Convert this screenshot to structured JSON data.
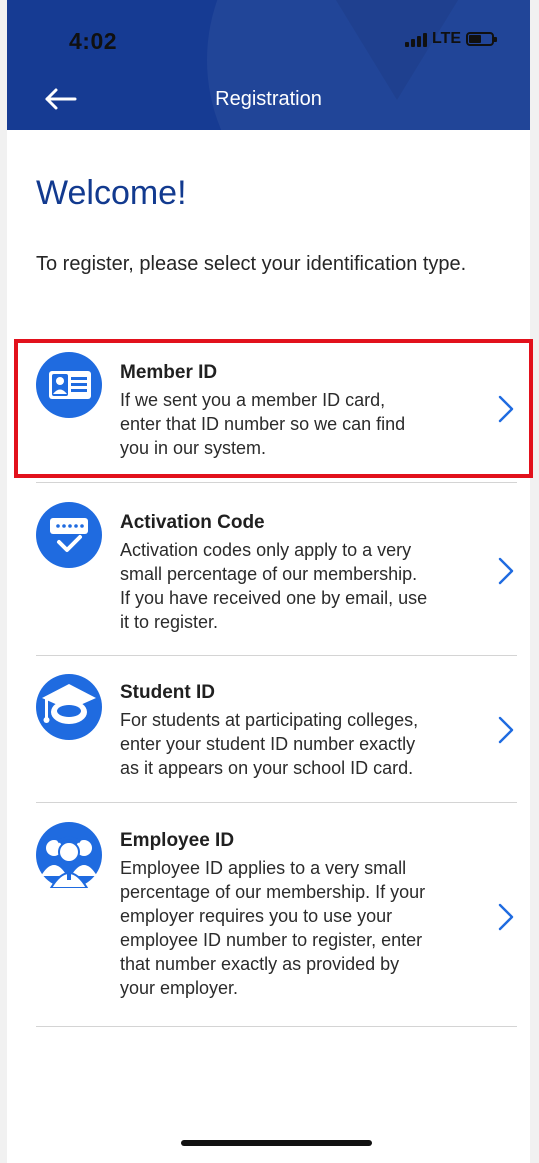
{
  "status_bar": {
    "time": "4:02",
    "network": "LTE"
  },
  "header": {
    "title": "Registration",
    "back_icon": "back-arrow-icon"
  },
  "welcome": "Welcome!",
  "intro": "To register, please select your identification type.",
  "options": [
    {
      "title": "Member ID",
      "lines": [
        "If we sent you a member ID card,",
        "enter that ID number so we can find",
        "you in our system."
      ],
      "icon": "id-card-icon",
      "highlighted": true
    },
    {
      "title": "Activation Code",
      "lines": [
        "Activation codes only apply to a very",
        "small percentage of our membership.",
        "If you have received one by email, use",
        "it to register."
      ],
      "icon": "activation-code-icon",
      "highlighted": false
    },
    {
      "title": "Student ID",
      "lines": [
        "For students at participating colleges,",
        "enter your student ID number exactly",
        "as it appears on your school ID card."
      ],
      "icon": "graduation-cap-icon",
      "highlighted": false
    },
    {
      "title": "Employee ID",
      "lines": [
        "Employee ID applies to a very small",
        "percentage of our membership. If your",
        "employer requires you to use your",
        "employee ID number to register, enter",
        "that number exactly as provided by",
        "your employer."
      ],
      "icon": "employees-icon",
      "highlighted": false
    }
  ],
  "colors": {
    "header_bg": "#163b93",
    "accent": "#1f6be0",
    "welcome_text": "#123a8f",
    "highlight": "#e2111c"
  }
}
